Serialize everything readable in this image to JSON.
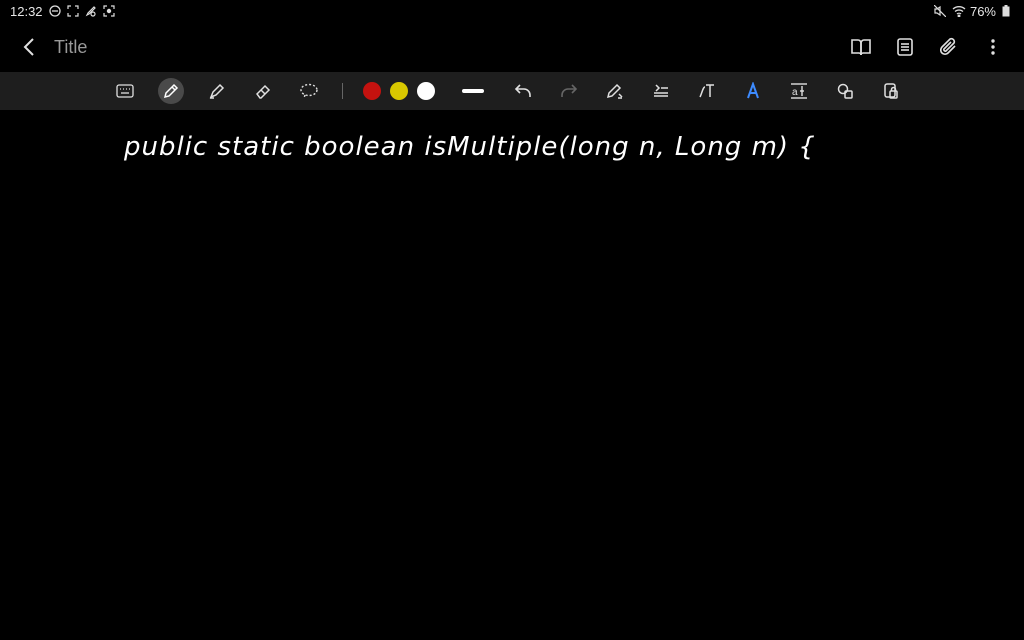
{
  "status": {
    "time": "12:32",
    "battery": "76%"
  },
  "header": {
    "title": "Title"
  },
  "toolbar": {
    "colors": [
      "#c4120f",
      "#d9c800",
      "#ffffff"
    ]
  },
  "canvas": {
    "handwriting": "public static boolean isMultiple(long n, Long m) {"
  }
}
